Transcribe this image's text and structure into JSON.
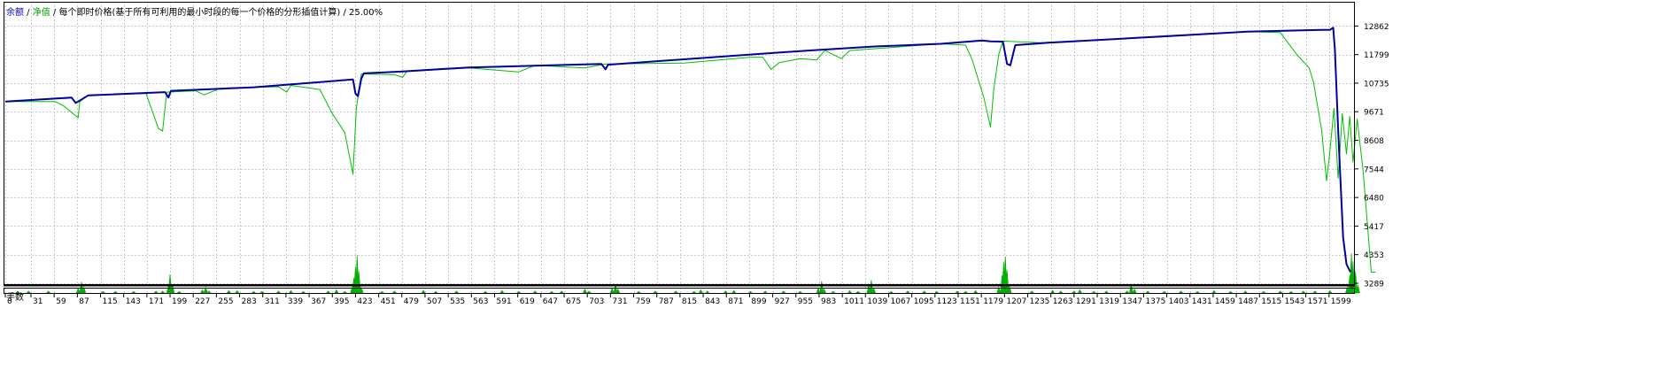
{
  "legend": {
    "balance": "余额",
    "sep1": " / ",
    "equity": "净值",
    "rest": " / 每个即时价格(基于所有可利用的最小时段的每一个价格的分形插值计算) / 25.00%"
  },
  "sub_panel_label": "手数",
  "colors": {
    "balance": "#0000a0",
    "equity": "#00c000",
    "lots": "#00b000",
    "grid": "#c8c8c8",
    "frame": "#000000"
  },
  "chart_data": [
    {
      "type": "line",
      "y_ticks": [
        3289,
        4353,
        5417,
        6480,
        7544,
        8608,
        9671,
        10735,
        11799,
        12862
      ],
      "ylim": [
        3289,
        13500
      ],
      "xlim": [
        0,
        1627
      ],
      "grid": true,
      "series": [
        {
          "name": "余额",
          "points": [
            [
              0,
              10050
            ],
            [
              80,
              10200
            ],
            [
              85,
              10000
            ],
            [
              88,
              10050
            ],
            [
              100,
              10280
            ],
            [
              193,
              10400
            ],
            [
              197,
              10200
            ],
            [
              200,
              10450
            ],
            [
              300,
              10580
            ],
            [
              420,
              10870
            ],
            [
              423,
              10350
            ],
            [
              426,
              10250
            ],
            [
              430,
              10900
            ],
            [
              433,
              11100
            ],
            [
              480,
              11170
            ],
            [
              560,
              11320
            ],
            [
              720,
              11450
            ],
            [
              725,
              11250
            ],
            [
              728,
              11420
            ],
            [
              900,
              11800
            ],
            [
              970,
              11950
            ],
            [
              1050,
              12100
            ],
            [
              1130,
              12200
            ],
            [
              1180,
              12320
            ],
            [
              1190,
              12290
            ],
            [
              1205,
              12280
            ],
            [
              1210,
              11450
            ],
            [
              1214,
              11400
            ],
            [
              1220,
              12150
            ],
            [
              1260,
              12240
            ],
            [
              1400,
              12480
            ],
            [
              1500,
              12650
            ],
            [
              1590,
              12720
            ],
            [
              1600,
              12720
            ],
            [
              1604,
              12800
            ],
            [
              1606,
              12000
            ],
            [
              1610,
              9000
            ],
            [
              1616,
              5000
            ],
            [
              1620,
              4000
            ],
            [
              1625,
              3700
            ]
          ]
        },
        {
          "name": "净值",
          "points": [
            [
              0,
              10050
            ],
            [
              60,
              10050
            ],
            [
              70,
              9900
            ],
            [
              88,
              9450
            ],
            [
              90,
              10050
            ],
            [
              100,
              10280
            ],
            [
              170,
              10350
            ],
            [
              185,
              9050
            ],
            [
              190,
              8950
            ],
            [
              195,
              10400
            ],
            [
              230,
              10450
            ],
            [
              240,
              10300
            ],
            [
              260,
              10550
            ],
            [
              330,
              10600
            ],
            [
              340,
              10400
            ],
            [
              345,
              10650
            ],
            [
              380,
              10500
            ],
            [
              395,
              9600
            ],
            [
              410,
              8900
            ],
            [
              420,
              7350
            ],
            [
              424,
              9800
            ],
            [
              430,
              11080
            ],
            [
              470,
              11050
            ],
            [
              480,
              10950
            ],
            [
              485,
              11170
            ],
            [
              560,
              11300
            ],
            [
              620,
              11150
            ],
            [
              640,
              11400
            ],
            [
              700,
              11300
            ],
            [
              725,
              11450
            ],
            [
              820,
              11480
            ],
            [
              900,
              11700
            ],
            [
              915,
              11700
            ],
            [
              925,
              11250
            ],
            [
              935,
              11500
            ],
            [
              960,
              11650
            ],
            [
              980,
              11600
            ],
            [
              990,
              11950
            ],
            [
              1010,
              11650
            ],
            [
              1020,
              11950
            ],
            [
              1130,
              12200
            ],
            [
              1160,
              12150
            ],
            [
              1168,
              11600
            ],
            [
              1175,
              10900
            ],
            [
              1182,
              10200
            ],
            [
              1190,
              9100
            ],
            [
              1194,
              10500
            ],
            [
              1200,
              11800
            ],
            [
              1205,
              12300
            ],
            [
              1250,
              12240
            ],
            [
              1400,
              12460
            ],
            [
              1500,
              12650
            ],
            [
              1540,
              12620
            ],
            [
              1560,
              11800
            ],
            [
              1575,
              11300
            ],
            [
              1580,
              10800
            ],
            [
              1590,
              9000
            ],
            [
              1596,
              7100
            ],
            [
              1600,
              8200
            ],
            [
              1605,
              9800
            ],
            [
              1610,
              7200
            ],
            [
              1615,
              9600
            ],
            [
              1620,
              8100
            ],
            [
              1624,
              9500
            ],
            [
              1628,
              7800
            ],
            [
              1633,
              9400
            ],
            [
              1640,
              7500
            ],
            [
              1650,
              3700
            ],
            [
              1655,
              3700
            ]
          ]
        }
      ]
    },
    {
      "type": "bar",
      "name": "手数",
      "x_ticks": [
        0,
        31,
        59,
        87,
        115,
        143,
        171,
        199,
        227,
        255,
        283,
        311,
        339,
        367,
        395,
        423,
        451,
        479,
        507,
        535,
        563,
        591,
        619,
        647,
        675,
        703,
        731,
        759,
        787,
        815,
        843,
        871,
        899,
        927,
        955,
        983,
        1011,
        1039,
        1067,
        1095,
        1123,
        1151,
        1179,
        1207,
        1235,
        1263,
        1291,
        1319,
        1347,
        1375,
        1403,
        1431,
        1459,
        1487,
        1515,
        1543,
        1571,
        1599
      ],
      "x_range": [
        0,
        1627
      ],
      "values": [
        [
          15,
          0.05
        ],
        [
          28,
          0.05
        ],
        [
          52,
          0.05
        ],
        [
          88,
          0.12
        ],
        [
          92,
          0.28
        ],
        [
          95,
          0.15
        ],
        [
          118,
          0.04
        ],
        [
          133,
          0.04
        ],
        [
          155,
          0.04
        ],
        [
          182,
          0.05
        ],
        [
          190,
          0.05
        ],
        [
          197,
          0.18
        ],
        [
          199,
          0.47
        ],
        [
          202,
          0.22
        ],
        [
          210,
          0.04
        ],
        [
          238,
          0.08
        ],
        [
          242,
          0.15
        ],
        [
          246,
          0.05
        ],
        [
          270,
          0.06
        ],
        [
          280,
          0.06
        ],
        [
          300,
          0.04
        ],
        [
          310,
          0.04
        ],
        [
          330,
          0.05
        ],
        [
          345,
          0.06
        ],
        [
          360,
          0.04
        ],
        [
          390,
          0.05
        ],
        [
          400,
          0.08
        ],
        [
          410,
          0.04
        ],
        [
          419,
          0.15
        ],
        [
          421,
          0.38
        ],
        [
          423,
          0.66
        ],
        [
          425,
          0.95
        ],
        [
          427,
          0.55
        ],
        [
          430,
          0.15
        ],
        [
          455,
          0.04
        ],
        [
          470,
          0.05
        ],
        [
          505,
          0.07
        ],
        [
          520,
          0.04
        ],
        [
          545,
          0.05
        ],
        [
          580,
          0.04
        ],
        [
          600,
          0.06
        ],
        [
          620,
          0.04
        ],
        [
          640,
          0.05
        ],
        [
          660,
          0.04
        ],
        [
          672,
          0.05
        ],
        [
          700,
          0.1
        ],
        [
          705,
          0.05
        ],
        [
          733,
          0.12
        ],
        [
          737,
          0.22
        ],
        [
          740,
          0.1
        ],
        [
          765,
          0.04
        ],
        [
          785,
          0.05
        ],
        [
          810,
          0.05
        ],
        [
          832,
          0.04
        ],
        [
          840,
          0.08
        ],
        [
          848,
          0.05
        ],
        [
          870,
          0.05
        ],
        [
          880,
          0.06
        ],
        [
          900,
          0.04
        ],
        [
          918,
          0.05
        ],
        [
          940,
          0.05
        ],
        [
          960,
          0.04
        ],
        [
          982,
          0.12
        ],
        [
          986,
          0.3
        ],
        [
          989,
          0.1
        ],
        [
          1000,
          0.04
        ],
        [
          1020,
          0.06
        ],
        [
          1030,
          0.04
        ],
        [
          1043,
          0.2
        ],
        [
          1046,
          0.32
        ],
        [
          1049,
          0.12
        ],
        [
          1070,
          0.04
        ],
        [
          1090,
          0.05
        ],
        [
          1110,
          0.05
        ],
        [
          1125,
          0.04
        ],
        [
          1150,
          0.05
        ],
        [
          1160,
          0.04
        ],
        [
          1172,
          0.06
        ],
        [
          1200,
          0.15
        ],
        [
          1204,
          0.45
        ],
        [
          1206,
          0.78
        ],
        [
          1208,
          0.92
        ],
        [
          1210,
          0.58
        ],
        [
          1213,
          0.18
        ],
        [
          1240,
          0.05
        ],
        [
          1265,
          0.07
        ],
        [
          1275,
          0.05
        ],
        [
          1291,
          0.05
        ],
        [
          1298,
          0.08
        ],
        [
          1315,
          0.04
        ],
        [
          1330,
          0.05
        ],
        [
          1355,
          0.05
        ],
        [
          1360,
          0.22
        ],
        [
          1364,
          0.1
        ],
        [
          1380,
          0.05
        ],
        [
          1400,
          0.04
        ],
        [
          1420,
          0.05
        ],
        [
          1440,
          0.04
        ],
        [
          1460,
          0.06
        ],
        [
          1480,
          0.04
        ],
        [
          1498,
          0.05
        ],
        [
          1520,
          0.04
        ],
        [
          1540,
          0.05
        ],
        [
          1553,
          0.04
        ],
        [
          1568,
          0.05
        ],
        [
          1582,
          0.05
        ],
        [
          1600,
          0.06
        ],
        [
          1621,
          0.15
        ],
        [
          1624,
          0.45
        ],
        [
          1626,
          1.0
        ],
        [
          1628,
          0.8
        ],
        [
          1631,
          0.55
        ],
        [
          1634,
          0.2
        ]
      ]
    }
  ]
}
